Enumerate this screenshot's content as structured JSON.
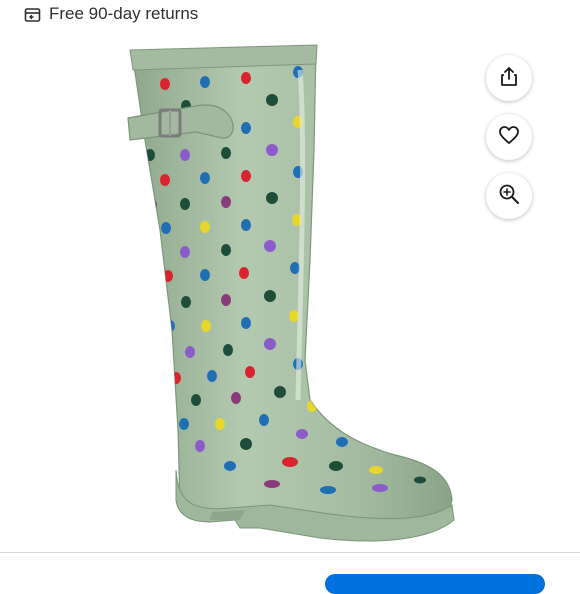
{
  "returns": {
    "text": "Free 90-day returns",
    "icon": "return-box-icon"
  },
  "product": {
    "image": "polka-dot-rain-boot",
    "boot_color": "#a8bfa5",
    "dot_colors": [
      "#d9232e",
      "#1f6fb5",
      "#e8d62a",
      "#8b5cc9",
      "#1e4d3a",
      "#8a3a7a"
    ]
  },
  "actions": [
    {
      "name": "share-button",
      "icon": "share-icon"
    },
    {
      "name": "favorite-button",
      "icon": "heart-icon"
    },
    {
      "name": "zoom-button",
      "icon": "zoom-in-icon"
    }
  ],
  "cta": {
    "color": "#0071dc"
  }
}
